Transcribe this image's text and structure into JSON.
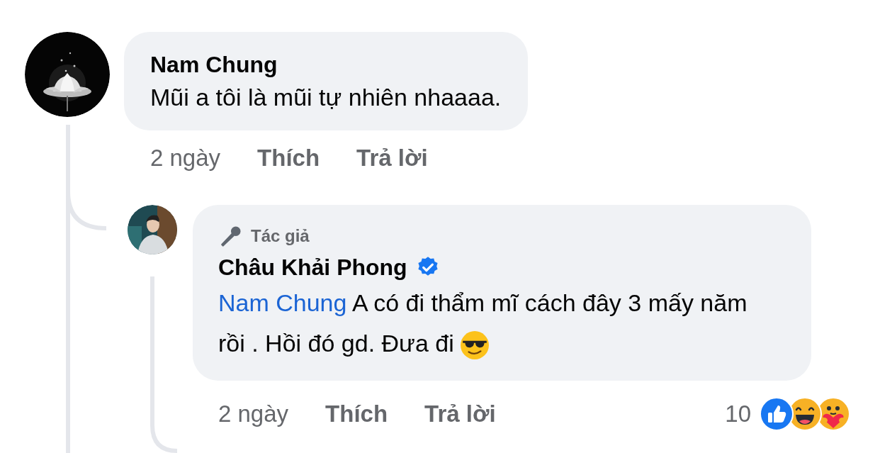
{
  "comment": {
    "author": "Nam Chung",
    "text": "Mũi a tôi là mũi tự nhiên nhaaaa.",
    "time": "2 ngày",
    "actions": [
      "Thích",
      "Trả lời"
    ]
  },
  "reply": {
    "badge": "Tác giả",
    "author": "Châu Khải Phong",
    "verified": true,
    "mention": "Nam Chung",
    "text": "A có đi thẩm mĩ cách đây 3 mấy năm rồi . Hồi đó gd. Đưa đi",
    "time": "2 ngày",
    "actions": [
      "Thích",
      "Trả lời"
    ],
    "reaction_count": "10",
    "reactions": [
      {
        "kind": "like"
      },
      {
        "kind": "haha"
      },
      {
        "kind": "care"
      }
    ]
  }
}
